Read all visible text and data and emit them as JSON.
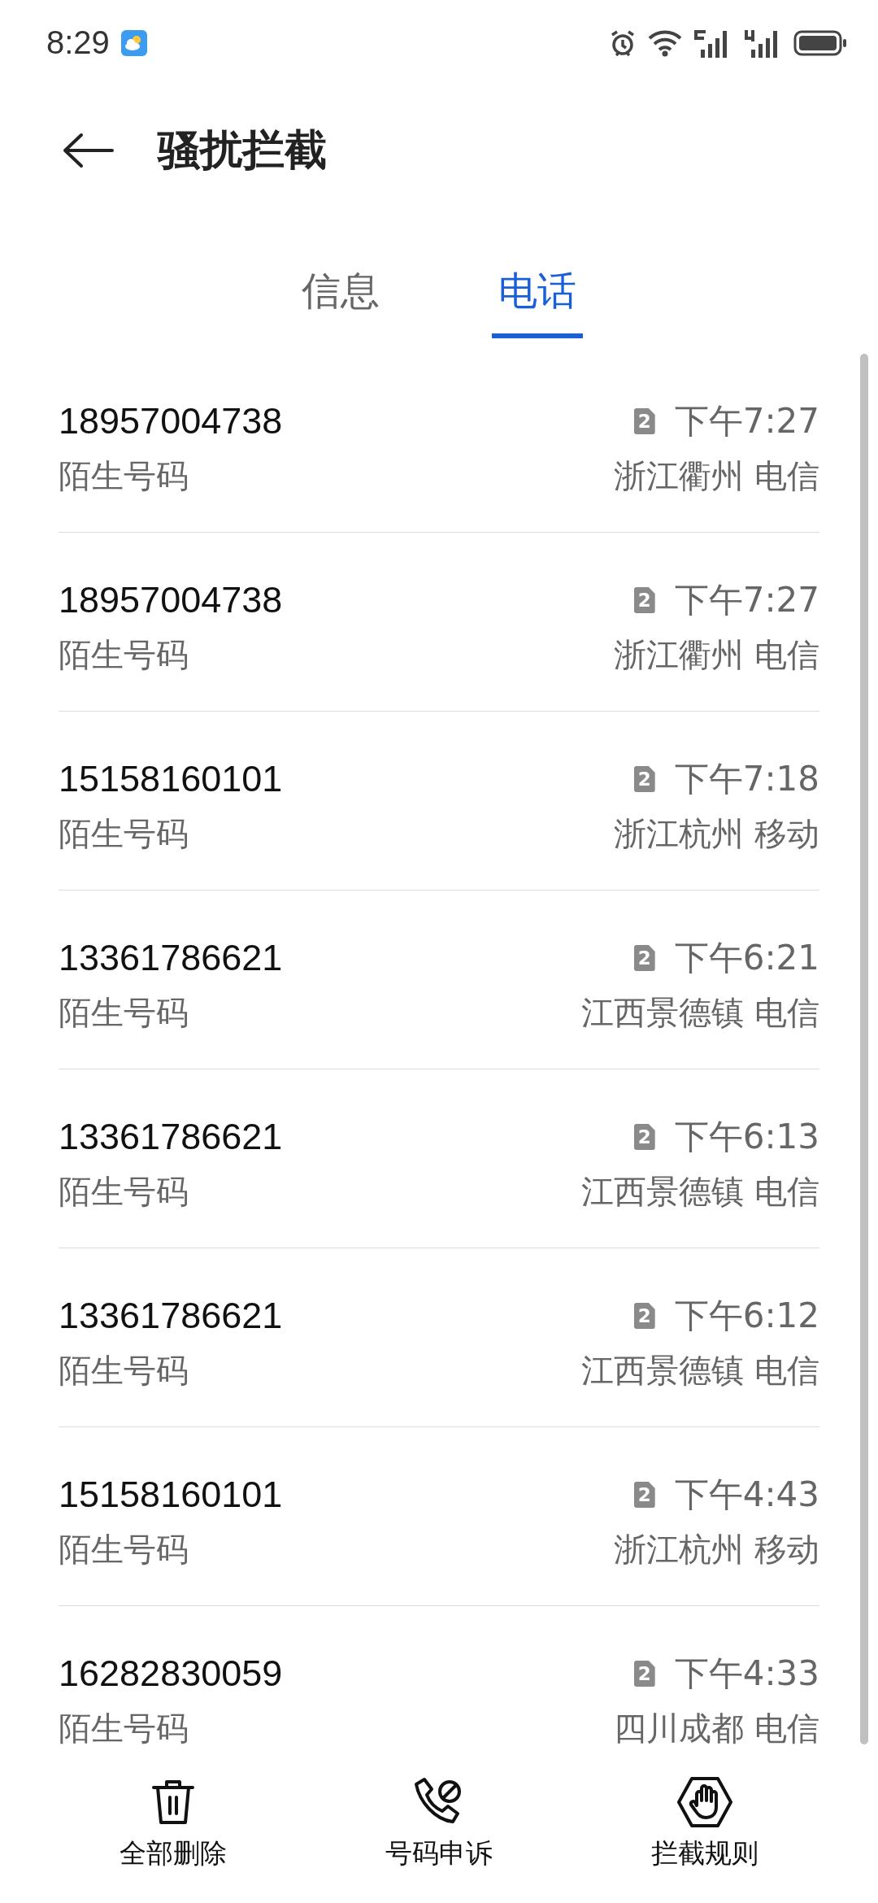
{
  "status_bar": {
    "time": "8:29"
  },
  "header": {
    "title": "骚扰拦截"
  },
  "tabs": [
    {
      "label": "信息",
      "selected": false
    },
    {
      "label": "电话",
      "selected": true
    }
  ],
  "calls": [
    {
      "number": "18957004738",
      "label": "陌生号码",
      "sim": "2",
      "time": "下午7:27",
      "location": "浙江衢州 电信"
    },
    {
      "number": "18957004738",
      "label": "陌生号码",
      "sim": "2",
      "time": "下午7:27",
      "location": "浙江衢州 电信"
    },
    {
      "number": "15158160101",
      "label": "陌生号码",
      "sim": "2",
      "time": "下午7:18",
      "location": "浙江杭州 移动"
    },
    {
      "number": "13361786621",
      "label": "陌生号码",
      "sim": "2",
      "time": "下午6:21",
      "location": "江西景德镇 电信"
    },
    {
      "number": "13361786621",
      "label": "陌生号码",
      "sim": "2",
      "time": "下午6:13",
      "location": "江西景德镇 电信"
    },
    {
      "number": "13361786621",
      "label": "陌生号码",
      "sim": "2",
      "time": "下午6:12",
      "location": "江西景德镇 电信"
    },
    {
      "number": "15158160101",
      "label": "陌生号码",
      "sim": "2",
      "time": "下午4:43",
      "location": "浙江杭州 移动"
    },
    {
      "number": "16282830059",
      "label": "陌生号码",
      "sim": "2",
      "time": "下午4:33",
      "location": "四川成都 电信"
    }
  ],
  "bottom_bar": [
    {
      "kind": "delete",
      "label": "全部删除"
    },
    {
      "kind": "appeal",
      "label": "号码申诉"
    },
    {
      "kind": "rules",
      "label": "拦截规则"
    }
  ]
}
